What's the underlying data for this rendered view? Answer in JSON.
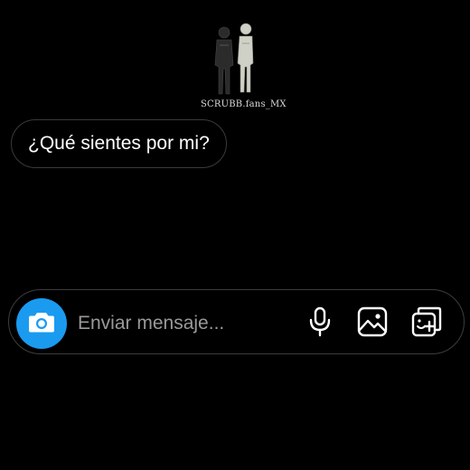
{
  "story_header": {
    "watermark": "SCRUBB.fans_MX"
  },
  "message": {
    "text": "¿Qué sientes por mi?"
  },
  "composer": {
    "placeholder": "Enviar mensaje...",
    "value": ""
  },
  "icons": {
    "camera": "camera-icon",
    "mic": "microphone-icon",
    "gallery": "image-icon",
    "sticker": "sticker-add-icon"
  },
  "colors": {
    "background": "#000000",
    "accent": "#1a9bf0",
    "placeholder": "#9a9a9a",
    "border": "#3d3d3d"
  }
}
